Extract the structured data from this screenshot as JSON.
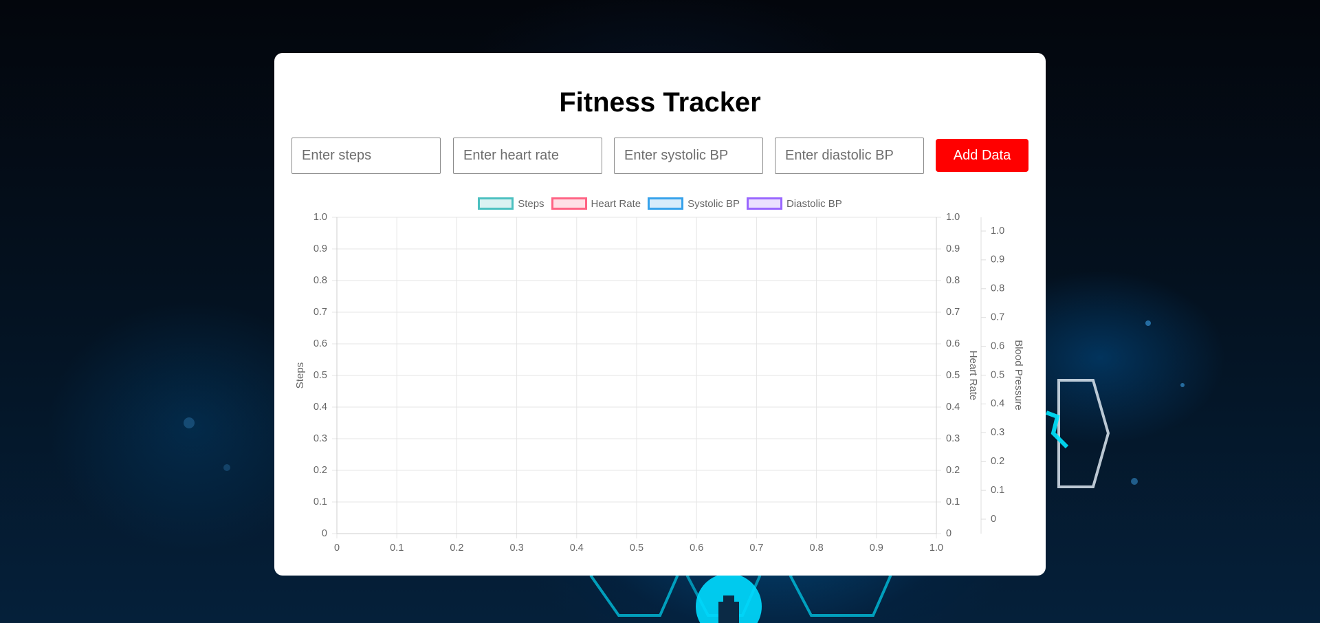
{
  "form": {
    "steps_placeholder": "Enter steps",
    "heart_rate_placeholder": "Enter heart rate",
    "systolic_placeholder": "Enter systolic BP",
    "diastolic_placeholder": "Enter diastolic BP",
    "add_button_label": "Add Data"
  },
  "app": {
    "title": "Fitness Tracker"
  },
  "colors": {
    "add_button": "#ff0000",
    "steps": "#4bc0c0",
    "heart_rate": "#ff6384",
    "systolic": "#36a2eb",
    "diastolic": "#9966ff"
  },
  "chart_data": {
    "type": "line",
    "title": "",
    "legend_position": "top",
    "grid": true,
    "series": [
      {
        "name": "Steps",
        "axis": "y-left",
        "values": []
      },
      {
        "name": "Heart Rate",
        "axis": "y-right",
        "values": []
      },
      {
        "name": "Systolic BP",
        "axis": "y-bp",
        "values": []
      },
      {
        "name": "Diastolic BP",
        "axis": "y-bp",
        "values": []
      }
    ],
    "x_axis": {
      "label": "",
      "range": [
        0,
        1
      ],
      "ticks": [
        "0",
        "0.1",
        "0.2",
        "0.3",
        "0.4",
        "0.5",
        "0.6",
        "0.7",
        "0.8",
        "0.9",
        "1.0"
      ]
    },
    "y_left": {
      "label": "Steps",
      "range": [
        0,
        1
      ],
      "ticks": [
        "0",
        "0.1",
        "0.2",
        "0.3",
        "0.4",
        "0.5",
        "0.6",
        "0.7",
        "0.8",
        "0.9",
        "1.0"
      ]
    },
    "y_right": {
      "label": "Heart Rate",
      "range": [
        0,
        1
      ],
      "ticks": [
        "0",
        "0.1",
        "0.2",
        "0.3",
        "0.4",
        "0.5",
        "0.6",
        "0.7",
        "0.8",
        "0.9",
        "1.0"
      ]
    },
    "y_bp": {
      "label": "Blood Pressure",
      "range": [
        0,
        1
      ],
      "ticks": [
        "0",
        "0.1",
        "0.2",
        "0.3",
        "0.4",
        "0.5",
        "0.6",
        "0.7",
        "0.8",
        "0.9",
        "1.0"
      ]
    }
  }
}
